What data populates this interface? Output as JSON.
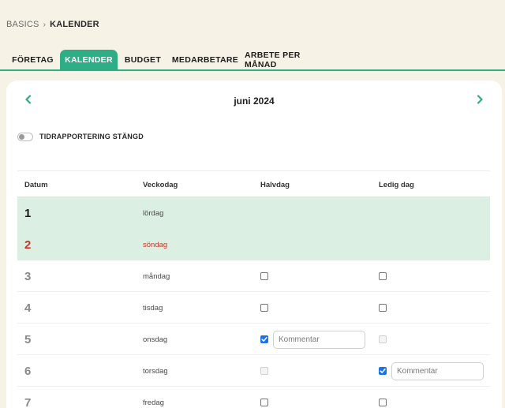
{
  "breadcrumb": {
    "root": "BASICS",
    "separator": "›",
    "current": "KALENDER"
  },
  "tabs": [
    {
      "label": "FÖRETAG",
      "active": false
    },
    {
      "label": "KALENDER",
      "active": true
    },
    {
      "label": "BUDGET",
      "active": false
    },
    {
      "label": "MEDARBETARE",
      "active": false
    },
    {
      "label": "ARBETE PER MÅNAD",
      "active": false
    }
  ],
  "calendar": {
    "month_label": "juni 2024",
    "toggle": {
      "label": "TIDRAPPORTERING STÄNGD",
      "on": false
    },
    "headers": {
      "date": "Datum",
      "weekday": "Veckodag",
      "halfday": "Halvdag",
      "dayoff": "Ledig dag"
    },
    "comment_placeholder": "Kommentar",
    "rows": [
      {
        "day": "1",
        "weekday": "lördag"
      },
      {
        "day": "2",
        "weekday": "söndag"
      },
      {
        "day": "3",
        "weekday": "måndag"
      },
      {
        "day": "4",
        "weekday": "tisdag"
      },
      {
        "day": "5",
        "weekday": "onsdag"
      },
      {
        "day": "6",
        "weekday": "torsdag"
      },
      {
        "day": "7",
        "weekday": "fredag"
      }
    ]
  },
  "colors": {
    "accent": "#2fae86",
    "weekend_row": "#dcefe3",
    "sunday_text": "#c0392b",
    "checkbox_checked": "#1a73e8",
    "background": "#f6f3e6"
  }
}
